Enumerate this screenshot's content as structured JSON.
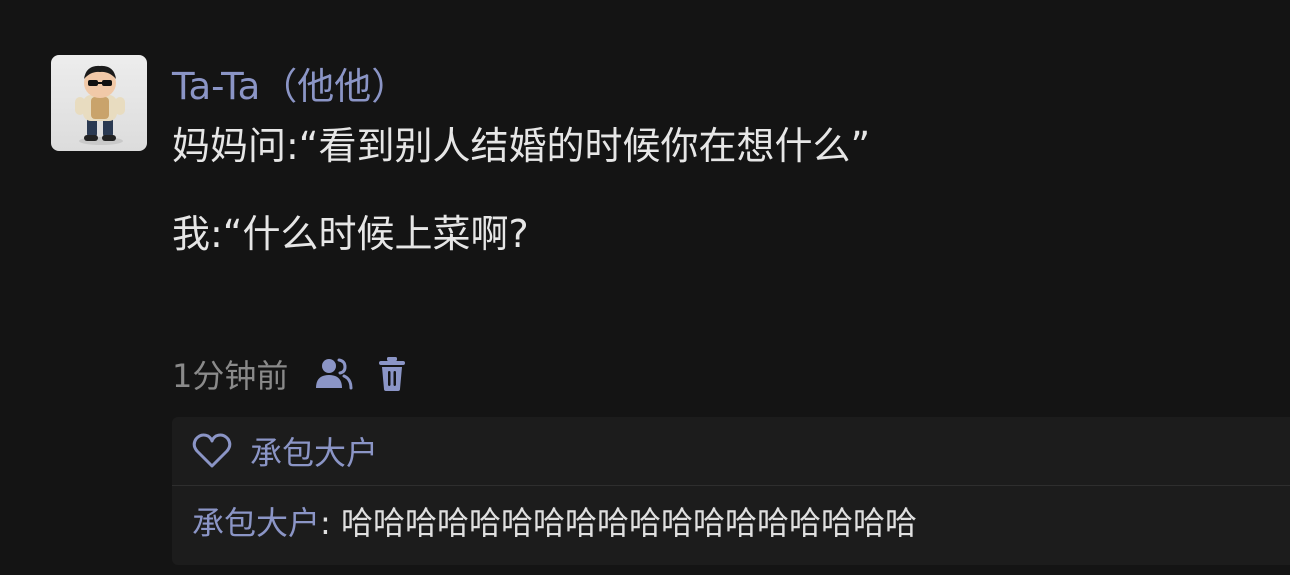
{
  "post": {
    "author": "Ta-Ta（他他）",
    "content_lines": [
      "妈妈问:“看到别人结婚的时候你在想什么”",
      "",
      "我:“什么时候上菜啊?"
    ],
    "timestamp": "1分钟前"
  },
  "icons": {
    "avatar": "avatar-figurine",
    "friends": "friends-icon",
    "delete": "trash-icon",
    "like": "heart-icon"
  },
  "likes": {
    "names": "承包大户"
  },
  "comments": [
    {
      "author": "承包大户",
      "separator": ": ",
      "text": "哈哈哈哈哈哈哈哈哈哈哈哈哈哈哈哈哈哈"
    }
  ],
  "colors": {
    "background": "#141414",
    "name_link": "#8b95c6",
    "text": "#e6e6e6",
    "muted": "#8a8a8a",
    "comment_bg": "#1c1c1c",
    "icon": "#8b95c6"
  }
}
